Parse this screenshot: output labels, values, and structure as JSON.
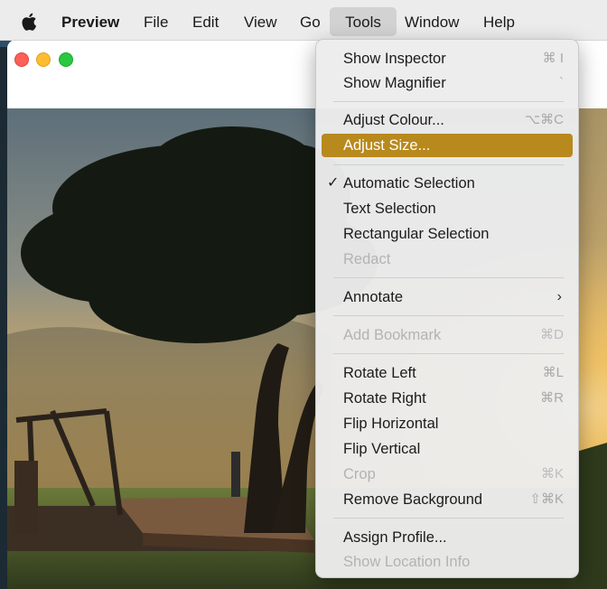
{
  "menubar": {
    "app_name": "Preview",
    "items": [
      "File",
      "Edit",
      "View",
      "Go",
      "Tools",
      "Window",
      "Help"
    ],
    "active_item": "Tools"
  },
  "tools_menu": {
    "show_inspector": {
      "label": "Show Inspector",
      "shortcut": "⌘ I"
    },
    "show_magnifier": {
      "label": "Show Magnifier",
      "shortcut": "`"
    },
    "adjust_colour": {
      "label": "Adjust Colour...",
      "shortcut": "⌥⌘C"
    },
    "adjust_size": {
      "label": "Adjust Size..."
    },
    "automatic_selection": {
      "label": "Automatic Selection",
      "check": "✓"
    },
    "text_selection": {
      "label": "Text Selection"
    },
    "rectangular_selection": {
      "label": "Rectangular Selection"
    },
    "redact": {
      "label": "Redact"
    },
    "annotate": {
      "label": "Annotate",
      "arrow": "›"
    },
    "add_bookmark": {
      "label": "Add Bookmark",
      "shortcut": "⌘D"
    },
    "rotate_left": {
      "label": "Rotate Left",
      "shortcut": "⌘L"
    },
    "rotate_right": {
      "label": "Rotate Right",
      "shortcut": "⌘R"
    },
    "flip_horizontal": {
      "label": "Flip Horizontal"
    },
    "flip_vertical": {
      "label": "Flip Vertical"
    },
    "crop": {
      "label": "Crop",
      "shortcut": "⌘K"
    },
    "remove_background": {
      "label": "Remove Background",
      "shortcut": "⇧⌘K"
    },
    "assign_profile": {
      "label": "Assign Profile..."
    },
    "show_location_info": {
      "label": "Show Location Info"
    }
  },
  "colors": {
    "highlight": "#b8891c",
    "close": "#fe5f57",
    "minimize": "#febc2e",
    "zoom": "#28c840"
  }
}
